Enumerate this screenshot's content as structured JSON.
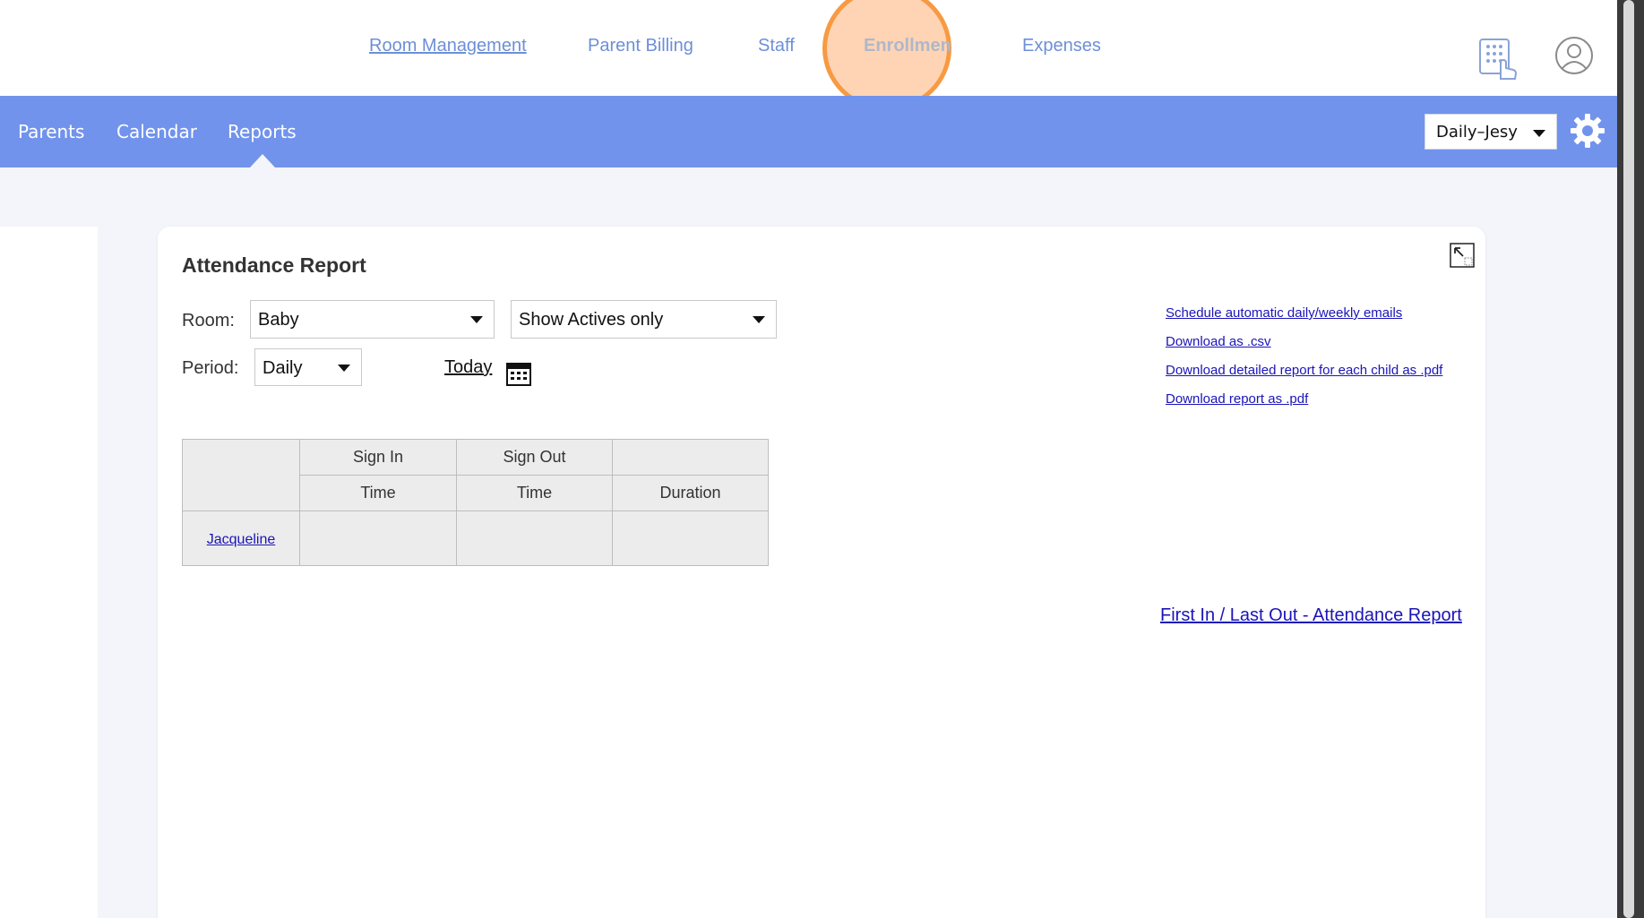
{
  "topnav": {
    "items": [
      {
        "label": "Room Management"
      },
      {
        "label": "Parent Billing"
      },
      {
        "label": "Staff"
      },
      {
        "label": "Enrollmen"
      },
      {
        "label": "Expenses"
      }
    ]
  },
  "subnav": {
    "items": [
      {
        "label": "Parents"
      },
      {
        "label": "Calendar"
      },
      {
        "label": "Reports"
      }
    ],
    "center_select": "Daily–Jesy"
  },
  "report": {
    "title": "Attendance Report",
    "room_label": "Room:",
    "room_value": "Baby",
    "filter_value": "Show Actives only",
    "period_label": "Period:",
    "period_value": "Daily",
    "today_label": "Today",
    "links": [
      "Schedule automatic daily/weekly emails",
      "Download as .csv",
      "Download detailed report for each child as .pdf",
      "Download report as .pdf"
    ],
    "bottom_link": "First In / Last Out - Attendance Report",
    "table": {
      "group_headers": [
        "Sign In",
        "Sign Out"
      ],
      "sub_headers": [
        "Time",
        "Time",
        "Duration"
      ],
      "rows": [
        {
          "name": "Jacqueline",
          "sign_in": "",
          "sign_out": "",
          "duration": ""
        }
      ]
    }
  },
  "icons": {
    "kiosk": "kiosk-keypad-icon",
    "user": "user-icon",
    "gear": "gear-icon",
    "expand": "expand-icon",
    "calendar": "calendar-icon"
  },
  "colors": {
    "accent": "#7193ec",
    "link": "#1a14b8",
    "nav_link": "#6d8fd8",
    "highlight": "#f79a42"
  }
}
